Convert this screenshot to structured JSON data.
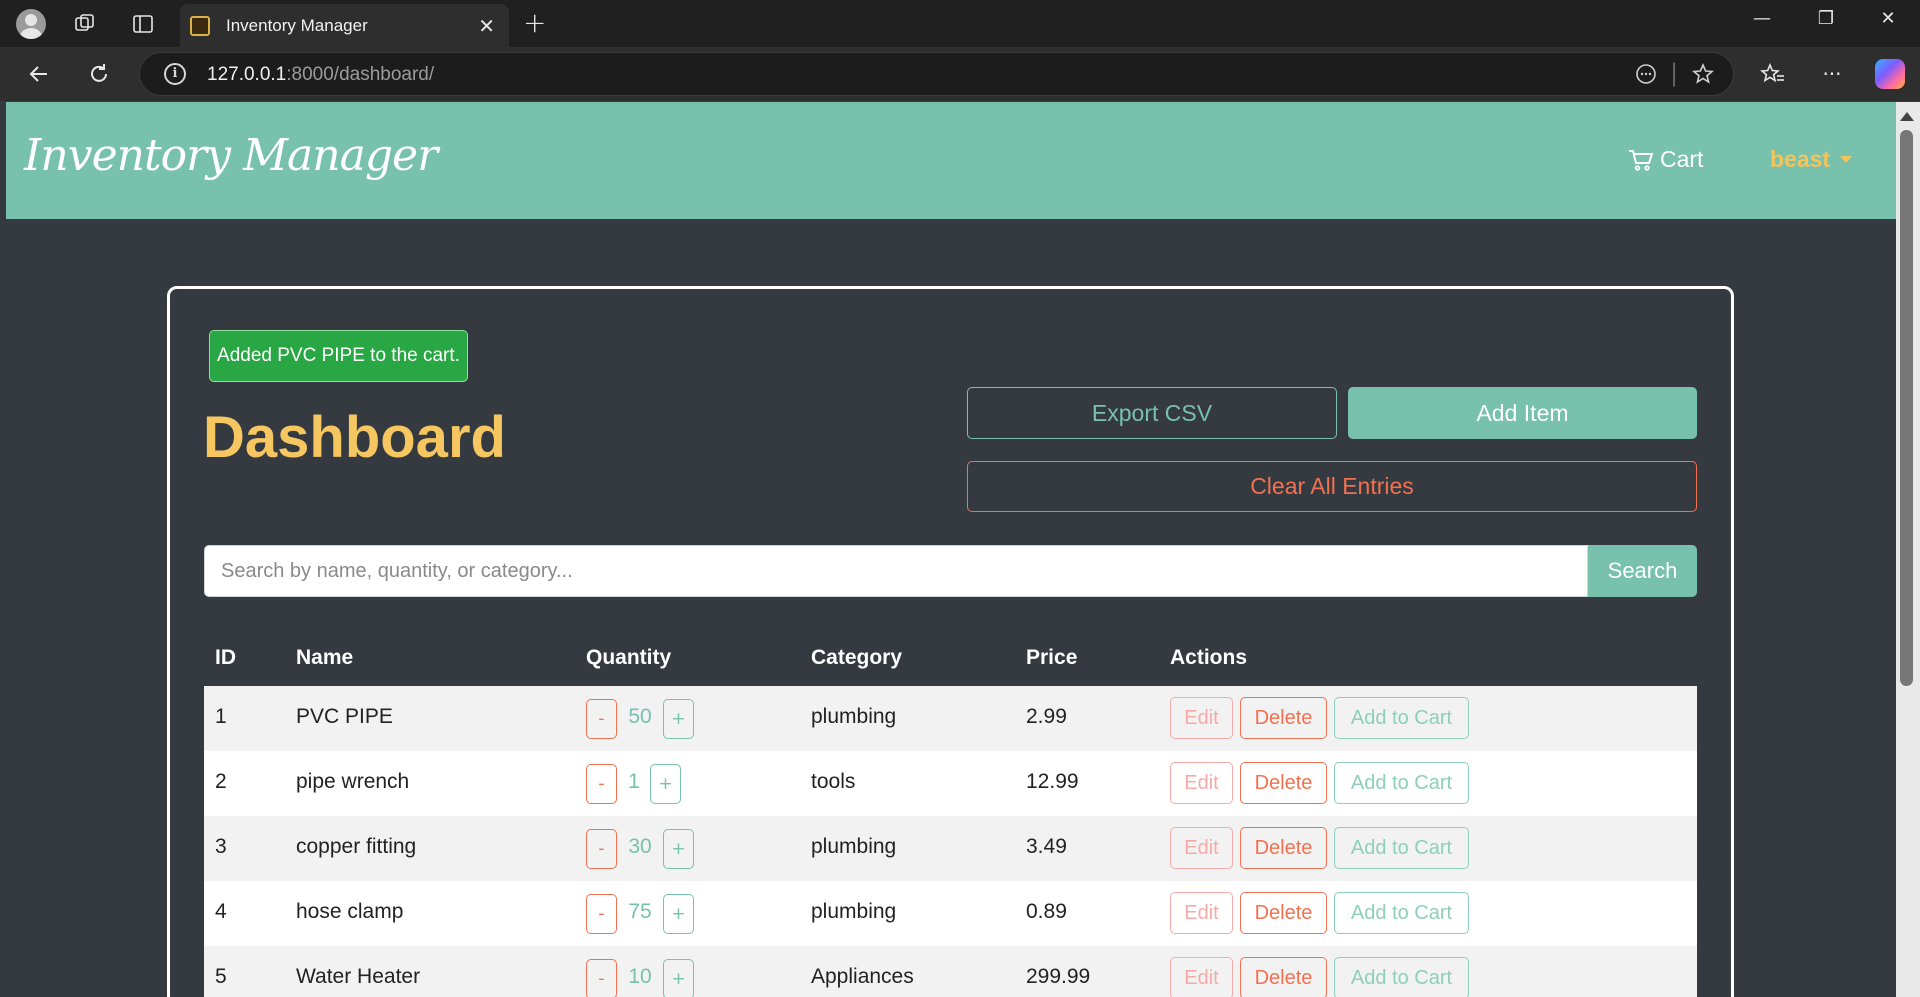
{
  "browser": {
    "tab_title": "Inventory Manager",
    "tab_close": "✕",
    "new_tab": "+",
    "url_host": "127.0.0.1",
    "url_path": ":8000/dashboard/",
    "min": "—",
    "restore": "❐",
    "close": "✕"
  },
  "navbar": {
    "brand": "Inventory Manager",
    "cart_label": "Cart",
    "user_name": "beast"
  },
  "alert": {
    "message": "Added PVC PIPE to the cart."
  },
  "page": {
    "title": "Dashboard",
    "export_label": "Export CSV",
    "add_label": "Add Item",
    "clear_label": "Clear All Entries",
    "search_placeholder": "Search by name, quantity, or category...",
    "search_label": "Search"
  },
  "table": {
    "headers": {
      "id": "ID",
      "name": "Name",
      "quantity": "Quantity",
      "category": "Category",
      "price": "Price",
      "actions": "Actions"
    },
    "minus_label": "-",
    "plus_label": "+",
    "edit_label": "Edit",
    "delete_label": "Delete",
    "cart_label": "Add to Cart",
    "rows": [
      {
        "id": "1",
        "name": "PVC PIPE",
        "quantity": "50",
        "category": "plumbing",
        "price": "2.99"
      },
      {
        "id": "2",
        "name": "pipe wrench",
        "quantity": "1",
        "category": "tools",
        "price": "12.99"
      },
      {
        "id": "3",
        "name": "copper fitting",
        "quantity": "30",
        "category": "plumbing",
        "price": "3.49"
      },
      {
        "id": "4",
        "name": "hose clamp",
        "quantity": "75",
        "category": "plumbing",
        "price": "0.89"
      },
      {
        "id": "5",
        "name": "Water Heater",
        "quantity": "10",
        "category": "Appliances",
        "price": "299.99"
      }
    ]
  },
  "colors": {
    "accent": "#77c1ad",
    "title": "#f6c660",
    "danger": "#f27151",
    "success": "#2aa745",
    "background": "#343a40"
  }
}
